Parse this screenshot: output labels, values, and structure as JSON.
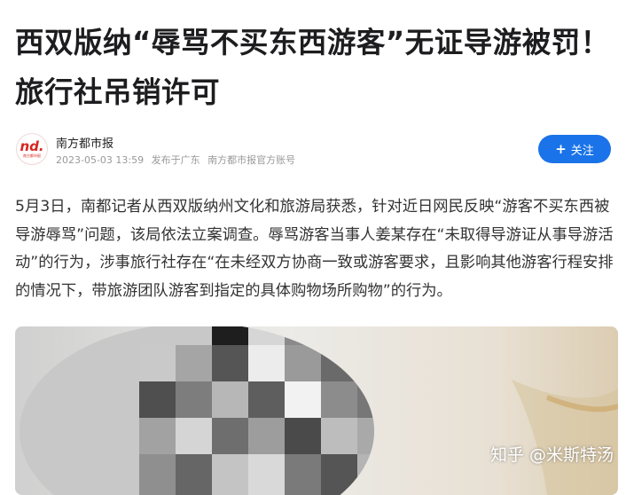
{
  "article": {
    "title": "西双版纳“辱骂不买东西游客”无证导游被罚！旅行社吊销许可",
    "author": {
      "avatar_text": "nd.",
      "avatar_subtext": "南方都市报",
      "name": "南方都市报",
      "date": "2023-05-03 13:59",
      "location": "发布于广东",
      "account_type": "南方都市报官方账号"
    },
    "follow_button": {
      "icon": "plus-icon",
      "plus": "+",
      "label": "关注",
      "color": "#1a73e8"
    },
    "paragraph": "5月3日，南都记者从西双版纳州文化和旅游局获悉，针对近日网民反映“游客不买东西被导游辱骂”问题，该局依法立案调查。辱骂游客当事人姜某存在“未取得导游证从事导游活动”的行为，涉事旅行社存在“在未经双方协商一致或游客要求，且影响其他游客行程安排的情况下，带旅游团队游客到指定的具体购物场所购物”的行为。",
    "image": {
      "description_icon": "pixelated-photo"
    },
    "watermark": "知乎 @米斯特汤"
  }
}
